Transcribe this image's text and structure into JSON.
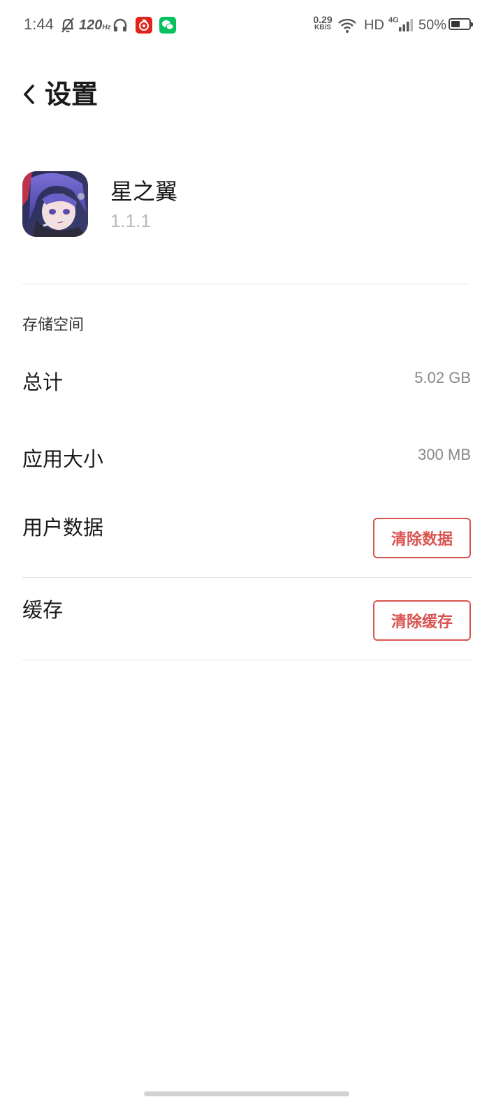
{
  "status_bar": {
    "time": "1:44",
    "refresh_rate": "120",
    "refresh_unit": "Hz",
    "net_speed_value": "0.29",
    "net_speed_unit": "KB/S",
    "hd_label": "HD",
    "network_type": "4G",
    "battery_percent": "50%",
    "battery_level": 0.5,
    "icons": [
      "mute-bell-icon",
      "headphones-icon",
      "netease-music-icon",
      "wechat-icon",
      "wifi-icon",
      "signal-icon",
      "battery-icon"
    ],
    "colors": {
      "netease": "#e2231a",
      "wechat": "#07c160"
    }
  },
  "header": {
    "title": "设置",
    "back_icon": "chevron-left-icon"
  },
  "app": {
    "name": "星之翼",
    "version": "1.1.1",
    "icon": "app-icon-anime-character"
  },
  "storage": {
    "section_title": "存储空间",
    "total_label": "总计",
    "total_value": "5.02 GB",
    "app_size_label": "应用大小",
    "app_size_value": "300 MB",
    "user_data_label": "用户数据",
    "clear_data_button": "清除数据",
    "cache_label": "缓存",
    "clear_cache_button": "清除缓存",
    "accent_color": "#d9534f"
  }
}
